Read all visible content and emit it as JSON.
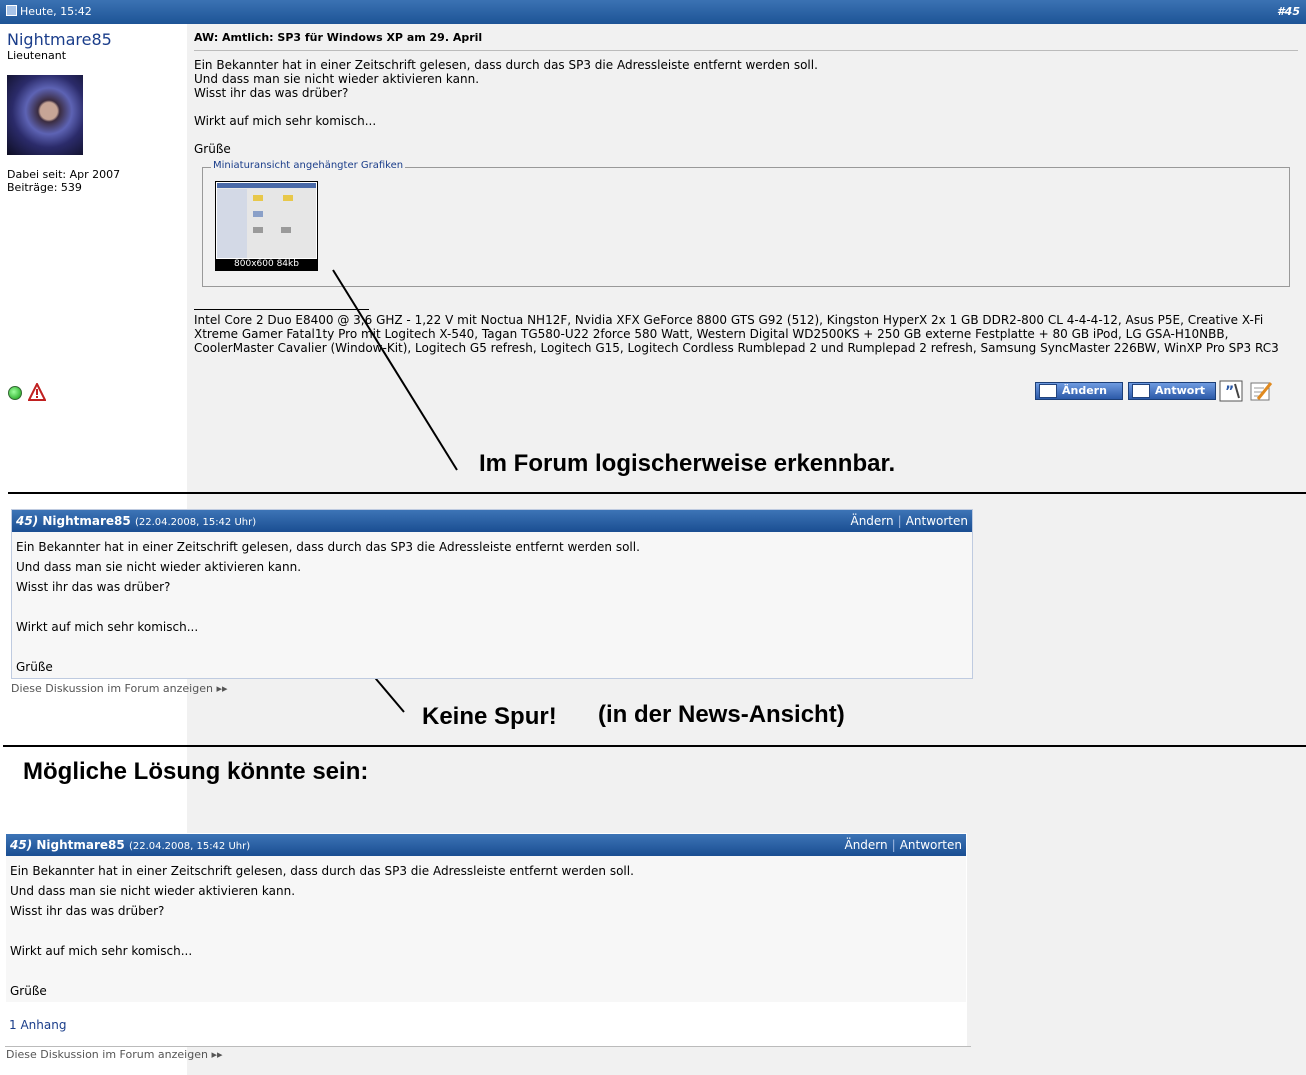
{
  "forum_post": {
    "date": "Heute, 15:42",
    "number": "#45",
    "user": {
      "name": "Nightmare85",
      "rank": "Lieutenant",
      "joined": "Dabei seit: Apr 2007",
      "posts": "Beiträge: 539"
    },
    "title": "AW: Amtlich: SP3 für Windows XP am 29. April",
    "body": [
      "Ein Bekannter hat in einer Zeitschrift gelesen, dass durch das SP3 die Adressleiste entfernt werden soll.",
      "Und dass man sie nicht wieder aktivieren kann.",
      "Wisst ihr das was drüber?",
      "",
      "Wirkt auf mich sehr komisch...",
      "",
      "Grüße"
    ],
    "attachments_legend": "Miniaturansicht angehängter Grafiken",
    "thumbnail_caption": "800x600  84kb",
    "signature": "Intel Core 2 Duo E8400 @ 3,6 GHZ - 1,22 V mit Noctua NH12F, Nvidia XFX GeForce 8800 GTS G92 (512), Kingston HyperX 2x 1 GB DDR2-800 CL 4-4-4-12, Asus P5E, Creative X-Fi Xtreme Gamer Fatal1ty Pro mit Logitech X-540, Tagan TG580-U22 2force 580 Watt, Western Digital WD2500KS + 250 GB externe Festplatte + 80 GB iPod, LG GSA-H10NBB, CoolerMaster Cavalier (Window-Kit), Logitech G5 refresh, Logitech G15, Logitech Cordless Rumblepad 2 und Rumplepad 2 refresh, Samsung SyncMaster 226BW, WinXP Pro SP3 RC3",
    "buttons": {
      "edit": "Ändern",
      "reply": "Antwort"
    }
  },
  "annotations": {
    "forum_visible": "Im Forum logischerweise erkennbar.",
    "no_trace": "Keine Spur!",
    "news_view": "(in der News-Ansicht)",
    "solution": "Mögliche Lösung könnte sein:"
  },
  "news_post_1": {
    "number": "45)",
    "author": "Nightmare85",
    "date": "(22.04.2008, 15:42 Uhr)",
    "edit": "Ändern",
    "reply": "Antworten",
    "lines": [
      "Ein Bekannter hat in einer Zeitschrift gelesen, dass durch das SP3 die Adressleiste entfernt werden soll.",
      "Und dass man sie nicht wieder aktivieren kann.",
      "Wisst ihr das was drüber?",
      "",
      "Wirkt auf mich sehr komisch...",
      "",
      "Grüße"
    ],
    "forum_link": "Diese Diskussion im Forum anzeigen"
  },
  "news_post_2": {
    "number": "45)",
    "author": "Nightmare85",
    "date": "(22.04.2008, 15:42 Uhr)",
    "edit": "Ändern",
    "reply": "Antworten",
    "lines": [
      "Ein Bekannter hat in einer Zeitschrift gelesen, dass durch das SP3 die Adressleiste entfernt werden soll.",
      "Und dass man sie nicht wieder aktivieren kann.",
      "Wisst ihr das was drüber?",
      "",
      "Wirkt auf mich sehr komisch...",
      "",
      "Grüße"
    ],
    "attachment_link": "1 Anhang",
    "forum_link": "Diese Diskussion im Forum anzeigen"
  },
  "colors": {
    "header_blue": "#1d5496",
    "link_blue": "#1a3d8a"
  }
}
